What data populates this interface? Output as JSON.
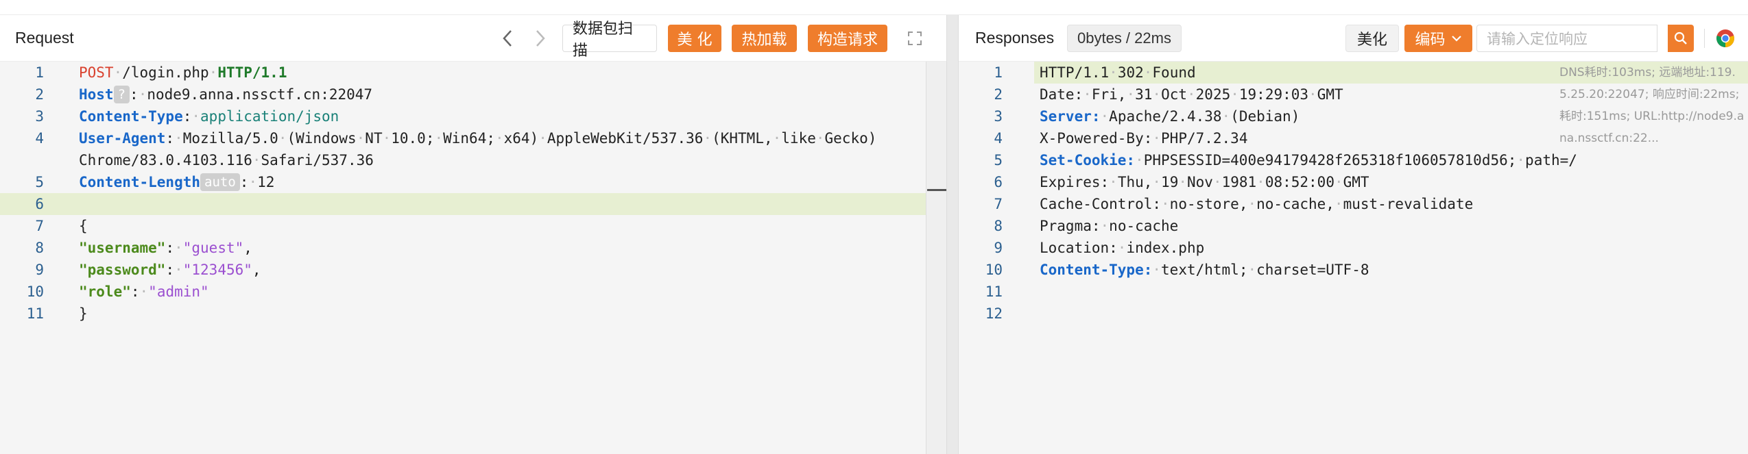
{
  "request": {
    "title": "Request",
    "buttons": {
      "scan": "数据包扫描",
      "beautify": "美 化",
      "hot_load": "热加载",
      "construct": "构造请求"
    },
    "line_numbers": [
      "1",
      "2",
      "3",
      "4",
      "",
      "5",
      "6",
      "7",
      "8",
      "9",
      "10",
      "11"
    ],
    "lines": {
      "l1_method": "POST",
      "l1_path": "/login.php",
      "l1_version": "HTTP/1.1",
      "l2_key": "Host",
      "l2_tag": "?",
      "l2_value": "node9.anna.nssctf.cn:22047",
      "l3_key": "Content-Type",
      "l3_value": "application/json",
      "l4_key": "User-Agent",
      "l4_value_a": "Mozilla/5.0 (Windows NT 10.0; Win64; x64) AppleWebKit/537.36 (KHTML, like Gecko)",
      "l4_value_b": "Chrome/83.0.4103.116 Safari/537.36",
      "l5_key": "Content-Length",
      "l5_tag": "auto",
      "l5_value": "12",
      "l7": "{",
      "l8_key": "\"username\"",
      "l8_value": "\"guest\"",
      "l9_key": "\"password\"",
      "l9_value": "\"123456\"",
      "l10_key": "\"role\"",
      "l10_value": "\"admin\"",
      "l11": "}"
    }
  },
  "response": {
    "title": "Responses",
    "stat": "0bytes / 22ms",
    "buttons": {
      "beautify": "美化",
      "encode": "编码"
    },
    "search_placeholder": "请输入定位响应",
    "line_numbers": [
      "1",
      "2",
      "3",
      "4",
      "5",
      "6",
      "7",
      "8",
      "9",
      "10",
      "11",
      "12"
    ],
    "lines": {
      "l1": "HTTP/1.1 302 Found",
      "l2": "Date: Fri, 31 Oct 2025 19:29:03 GMT",
      "l3_key": "Server:",
      "l3_value": "Apache/2.4.38 (Debian)",
      "l4": "X-Powered-By: PHP/7.2.34",
      "l5_key": "Set-Cookie:",
      "l5_value": "PHPSESSID=400e94179428f265318f106057810d56; path=/",
      "l6": "Expires: Thu, 19 Nov 1981 08:52:00 GMT",
      "l7": "Cache-Control: no-store, no-cache, must-revalidate",
      "l8": "Pragma: no-cache",
      "l9": "Location: index.php",
      "l10_key": "Content-Type:",
      "l10_value": "text/html; charset=UTF-8"
    },
    "meta": [
      "DNS耗时:103ms; 远端地址:119.",
      "5.25.20:22047; 响应时间:22ms;",
      "耗时:151ms; URL:http://node9.a",
      "na.nssctf.cn:22..."
    ]
  },
  "colors": {
    "accent": "#ef7d2c",
    "active_line": "#e7efd2",
    "header_key_blue": "#1967c9",
    "method_red": "#d9412e",
    "json_key_green": "#4c8a1c",
    "json_string_purple": "#9b4fd0"
  },
  "icons": [
    "chevron-left-icon",
    "chevron-right-icon",
    "expand-icon",
    "chevron-down-icon",
    "search-icon",
    "chrome-icon"
  ]
}
